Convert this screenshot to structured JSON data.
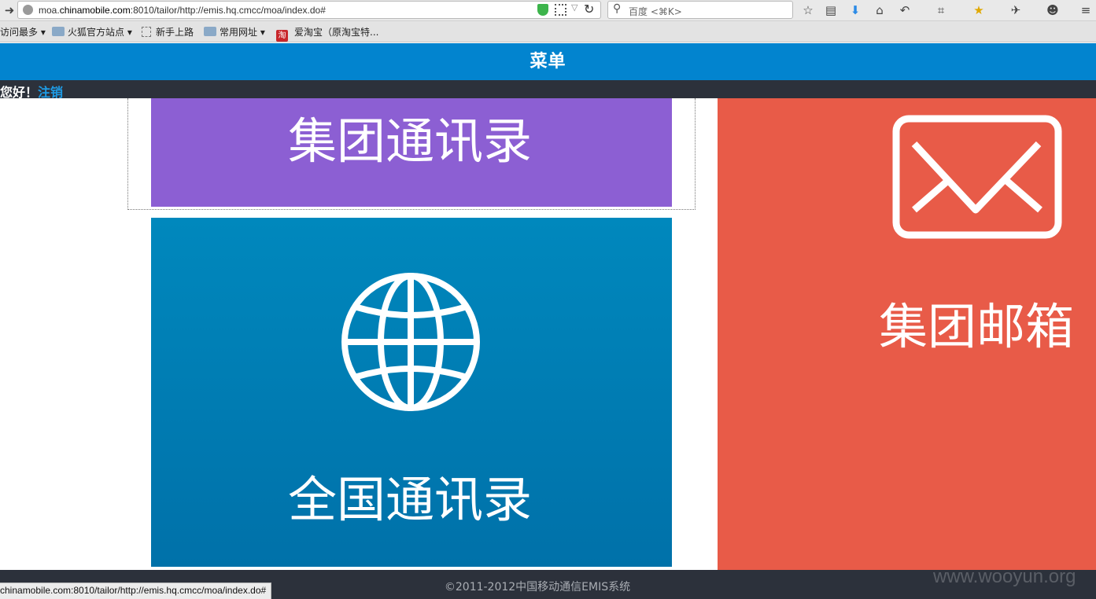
{
  "browser": {
    "url_prefix": "moa.",
    "url_host": "chinamobile.com",
    "url_rest": ":8010/tailor/http://emis.hq.cmcc/moa/index.do#",
    "search_placeholder": "百度 <⌘K>",
    "bookmarks": [
      {
        "label": "访问最多",
        "icon": "none"
      },
      {
        "label": "火狐官方站点",
        "icon": "folder-icon"
      },
      {
        "label": "新手上路",
        "icon": "blank-page-icon"
      },
      {
        "label": "常用网址",
        "icon": "folder-icon"
      },
      {
        "label": "爱淘宝（原淘宝特...",
        "icon": "taobao-icon",
        "icon_text": "淘"
      }
    ],
    "status_url": "chinamobile.com:8010/tailor/http://emis.hq.cmcc/moa/index.do#"
  },
  "app": {
    "title": "菜单",
    "greeting": "您好！",
    "logout_label": "注销",
    "tiles": {
      "group_directory": "集团通讯录",
      "national_directory": "全国通讯录",
      "group_mail": "集团邮箱"
    },
    "footer": "©2011-2012中国移动通信EMIS系统",
    "watermark": "www.wooyun.org"
  },
  "colors": {
    "header": "#0284cf",
    "purple_tile": "#8c5fd3",
    "blue_tile": "#0080b8",
    "mail_tile": "#e85b48",
    "dark_bar": "#2c313b",
    "link": "#1e9ce6"
  }
}
